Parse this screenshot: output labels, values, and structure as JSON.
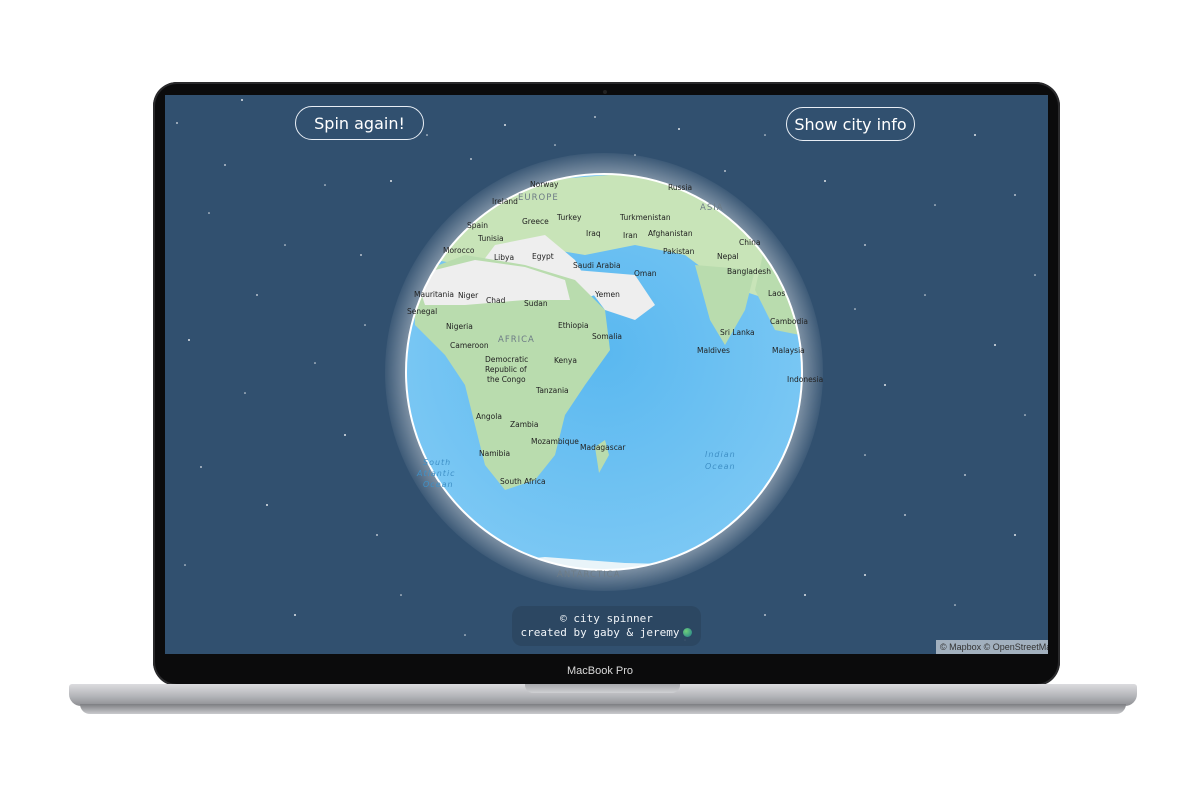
{
  "device": {
    "label": "MacBook Pro"
  },
  "toolbar": {
    "spin_label": "Spin again!",
    "info_label": "Show city info"
  },
  "footer": {
    "line1": "© city spinner",
    "line2": "created by gaby & jeremy"
  },
  "attribution": "© Mapbox © OpenStreetMap",
  "map": {
    "continents": [
      "EUROPE",
      "ASIA",
      "AFRICA",
      "ANTARCTICA"
    ],
    "countries": [
      "Norway",
      "Russia",
      "Ireland",
      "Spain",
      "Greece",
      "Turkey",
      "Turkmenistan",
      "Tunisia",
      "Iraq",
      "Iran",
      "Afghanistan",
      "China",
      "Morocco",
      "Libya",
      "Egypt",
      "Saudi Arabia",
      "Pakistan",
      "Nepal",
      "Bangladesh",
      "Oman",
      "Mauritania",
      "Niger",
      "Chad",
      "Sudan",
      "Yemen",
      "Laos",
      "Senegal",
      "Nigeria",
      "Ethiopia",
      "Somalia",
      "Sri Lanka",
      "Cambodia",
      "Cameroon",
      "Democratic",
      "Republic of",
      "the Congo",
      "Kenya",
      "Maldives",
      "Malaysia",
      "Indonesia",
      "Tanzania",
      "Angola",
      "Zambia",
      "Mozambique",
      "Madagascar",
      "Namibia",
      "South Africa"
    ],
    "oceans": [
      "South",
      "Atlantic",
      "Ocean",
      "Indian",
      "Ocean"
    ]
  },
  "colors": {
    "background": "#31506f",
    "ocean": "#5ab8f0",
    "land": "#b9dcae",
    "desert": "#eeeeee"
  }
}
